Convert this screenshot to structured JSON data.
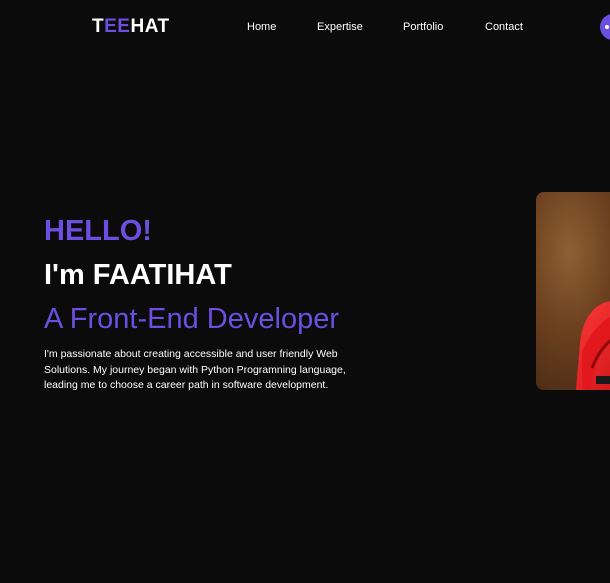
{
  "header": {
    "logo": {
      "part1": "T",
      "part2": "EE",
      "part3": "HAT"
    },
    "nav": [
      {
        "label": "Home"
      },
      {
        "label": "Expertise"
      },
      {
        "label": "Portfolio"
      },
      {
        "label": "Contact"
      }
    ]
  },
  "hero": {
    "greeting": "HELLO!",
    "name": "I'm FAATIHAT",
    "role": "A Front-End Developer",
    "bio_lines": [
      "I'm passionate about creating accessible and user friendly Web",
      "Solutions. My journey began with Python Programning language,",
      "leading me to choose a career path in software development."
    ]
  },
  "colors": {
    "background": "#0b0b0c",
    "accent": "#6a4fe0",
    "text": "#ffffff"
  }
}
